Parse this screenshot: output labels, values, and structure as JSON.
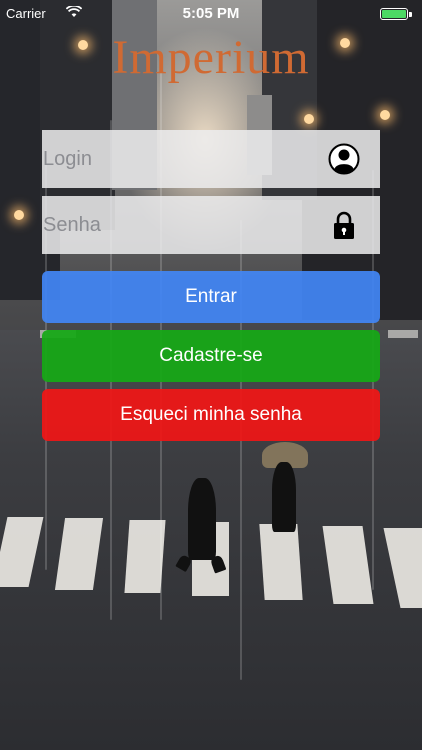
{
  "status_bar": {
    "carrier": "Carrier",
    "time": "5:05 PM",
    "battery_level": 1.0,
    "battery_color": "#4cd964"
  },
  "app": {
    "title": "Imperium",
    "title_color": "#d06a33"
  },
  "form": {
    "login_placeholder": "Login",
    "login_value": "",
    "login_icon": "user-icon",
    "senha_placeholder": "Senha",
    "senha_value": "",
    "senha_icon": "lock-icon"
  },
  "buttons": {
    "entrar": {
      "label": "Entrar",
      "color": "#4285f4"
    },
    "cadastro": {
      "label": "Cadastre-se",
      "color": "#16a816"
    },
    "esqueci": {
      "label": "Esqueci minha senha",
      "color": "#ee1616"
    }
  }
}
